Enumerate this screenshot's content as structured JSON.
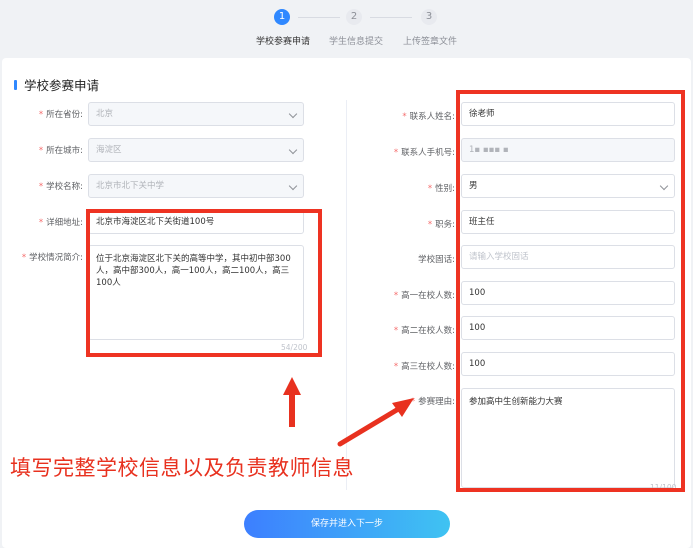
{
  "stepper": {
    "steps": [
      {
        "number": "1",
        "label": "学校参赛申请"
      },
      {
        "number": "2",
        "label": "学生信息提交"
      },
      {
        "number": "3",
        "label": "上传签章文件"
      }
    ]
  },
  "section_title": "学校参赛申请",
  "left": {
    "province": {
      "label": "所在省份:",
      "value": "北京"
    },
    "city": {
      "label": "所在城市:",
      "value": "海淀区"
    },
    "school": {
      "label": "学校名称:",
      "value": "北京市北下关中学"
    },
    "address": {
      "label": "详细地址:",
      "value": "北京市海淀区北下关街道100号"
    },
    "intro": {
      "label": "学校情况简介:",
      "value": "位于北京海淀区北下关的高等中学，其中初中部300人，高中部300人，高一100人，高二100人，高三100人",
      "counter": "54/200"
    }
  },
  "right": {
    "contact_name": {
      "label": "联系人姓名:",
      "value": "徐老师"
    },
    "contact_phone": {
      "label": "联系人手机号:",
      "value": "1▪ ▪▪▪ ▪"
    },
    "gender": {
      "label": "性别:",
      "value": "男"
    },
    "title": {
      "label": "职务:",
      "value": "班主任"
    },
    "school_phone": {
      "label": "学校固话:",
      "placeholder": "请输入学校固话"
    },
    "grade1": {
      "label": "高一在校人数:",
      "value": "100"
    },
    "grade2": {
      "label": "高二在校人数:",
      "value": "100"
    },
    "grade3": {
      "label": "高三在校人数:",
      "value": "100"
    },
    "reason": {
      "label": "参赛理由:",
      "value": "参加高中生创新能力大赛",
      "counter": "11/100"
    }
  },
  "annotation": "填写完整学校信息以及负责教师信息",
  "submit_label": "保存并进入下一步",
  "colors": {
    "primary": "#2f88ff",
    "annotation_red": "#ee3322",
    "required": "#f56c6c"
  }
}
